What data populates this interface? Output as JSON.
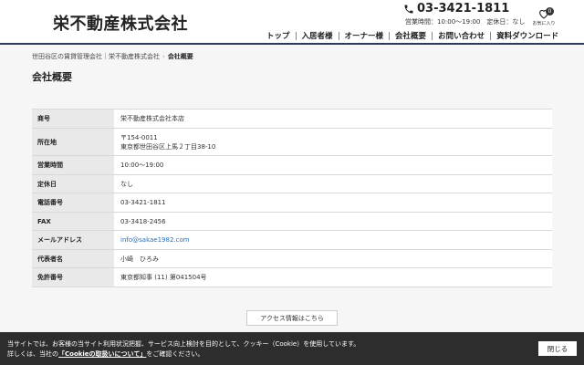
{
  "header": {
    "logo": "栄不動産株式会社",
    "phone": "03-3421-1811",
    "hours": "営業時間：10:00〜19:00　定休日：なし",
    "favorite": {
      "count": "0",
      "label": "お気に入り"
    }
  },
  "nav": {
    "items": [
      "トップ",
      "入居者様",
      "オーナー様",
      "会社概要",
      "お問い合わせ",
      "資料ダウンロード"
    ]
  },
  "breadcrumb": {
    "items": [
      "世田谷区の賃貸管理会社｜栄不動産株式会社"
    ],
    "current": "会社概要",
    "separator": "›"
  },
  "page": {
    "title": "会社概要"
  },
  "table": {
    "rows": [
      {
        "label": "商号",
        "value": "栄不動産株式会社本店"
      },
      {
        "label": "所在地",
        "value": "〒154-0011",
        "value2": "東京都世田谷区上馬２丁目38-10"
      },
      {
        "label": "営業時間",
        "value": "10:00〜19:00"
      },
      {
        "label": "定休日",
        "value": "なし"
      },
      {
        "label": "電話番号",
        "value": "03-3421-1811"
      },
      {
        "label": "FAX",
        "value": "03-3418-2456"
      },
      {
        "label": "メールアドレス",
        "value": "info@sakae1982.com"
      },
      {
        "label": "代表者名",
        "value": "小崎　ひろみ"
      },
      {
        "label": "免許番号",
        "value": "東京都知事 (11) 第041504号"
      }
    ]
  },
  "access_button": "アクセス情報はこちら",
  "cookie": {
    "line1": "当サイトでは、お客様の当サイト利用状況把握、サービス向上検討を目的として、クッキー（Cookie）を使用しています。",
    "line2_prefix": "詳しくは、当社の",
    "line2_link": "「Cookieの取扱いについて」",
    "line2_suffix": "をご確認ください。",
    "close": "閉じる"
  },
  "colors": {
    "header_line": "#2c3a5c",
    "link": "#2a6fb8",
    "cookie_bg": "#2d2d2d",
    "background": "#f6f6f6"
  }
}
